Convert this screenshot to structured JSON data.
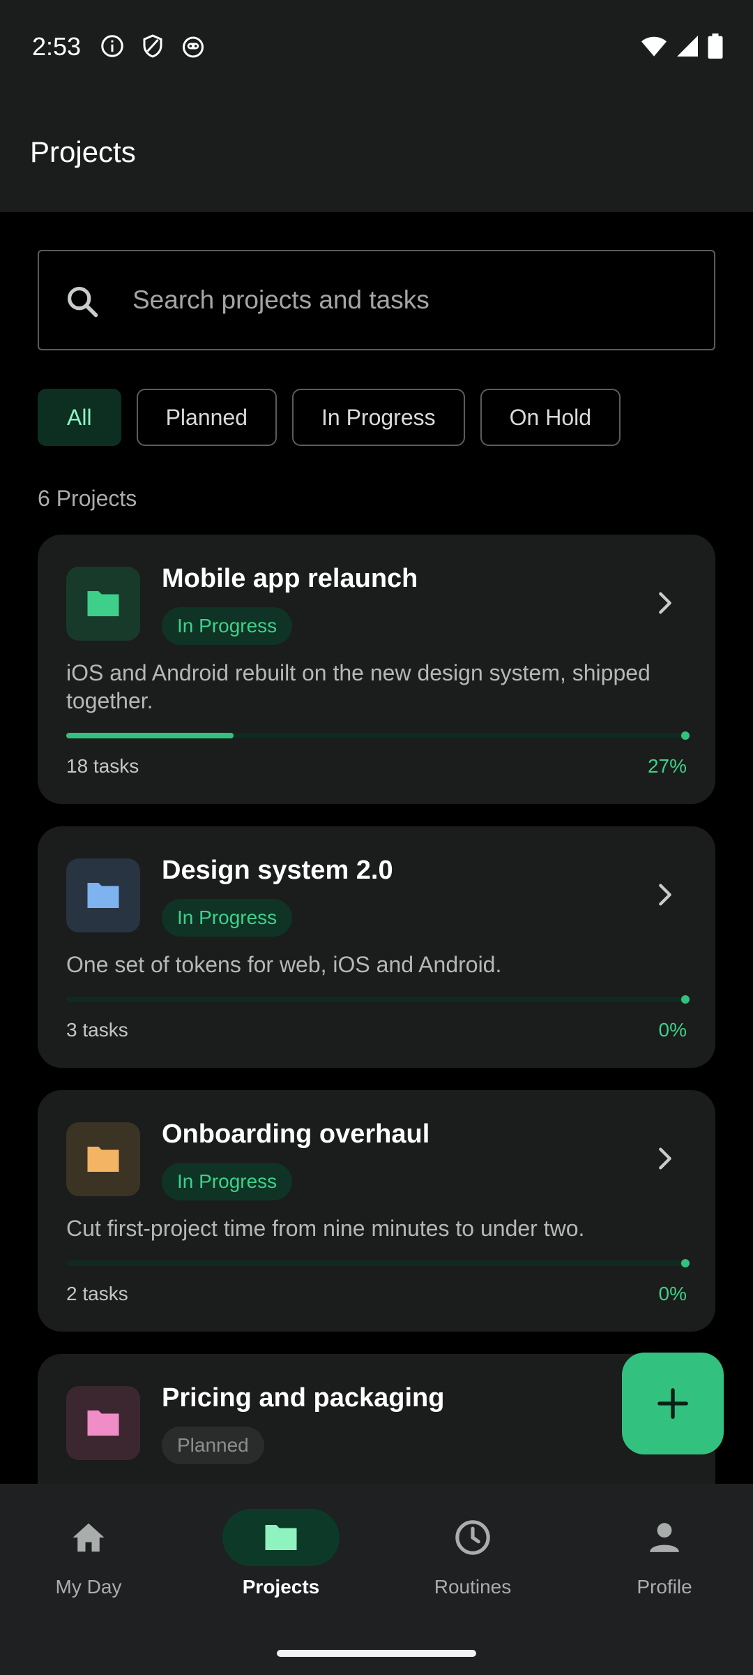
{
  "status_bar": {
    "time": "2:53",
    "left_icons": [
      "info-icon",
      "shield-icon",
      "robot-icon"
    ],
    "right_icons": [
      "wifi-icon",
      "signal-icon",
      "battery-icon"
    ]
  },
  "app_bar": {
    "title": "Projects"
  },
  "search": {
    "placeholder": "Search projects and tasks",
    "value": ""
  },
  "filters": [
    {
      "label": "All",
      "active": true
    },
    {
      "label": "Planned",
      "active": false
    },
    {
      "label": "In Progress",
      "active": false
    },
    {
      "label": "On Hold",
      "active": false
    }
  ],
  "project_count": "6 Projects",
  "projects": [
    {
      "title": "Mobile app relaunch",
      "status": "In Progress",
      "description": "iOS and Android rebuilt on the new design system, shipped together.",
      "tasks": "18 tasks",
      "percent": "27%",
      "progress": 0.27,
      "icon_color": "#3ecf8a",
      "icon_bg": "#173a2a"
    },
    {
      "title": "Design system 2.0",
      "status": "In Progress",
      "description": "One set of tokens for web, iOS and Android.",
      "tasks": "3 tasks",
      "percent": "0%",
      "progress": 0,
      "icon_color": "#7fb3f0",
      "icon_bg": "#283442"
    },
    {
      "title": "Onboarding overhaul",
      "status": "In Progress",
      "description": "Cut first-project time from nine minutes to under two.",
      "tasks": "2 tasks",
      "percent": "0%",
      "progress": 0,
      "icon_color": "#f3b463",
      "icon_bg": "#3b3324"
    },
    {
      "title": "Pricing and packaging",
      "status": "Planned",
      "icon_color": "#f08dc7",
      "icon_bg": "#3c2731"
    }
  ],
  "fab": {
    "icon": "plus-icon"
  },
  "bottom_nav": [
    {
      "label": "My Day",
      "icon": "home-icon",
      "active": false
    },
    {
      "label": "Projects",
      "icon": "folder-icon",
      "active": true
    },
    {
      "label": "Routines",
      "icon": "clock-icon",
      "active": false
    },
    {
      "label": "Profile",
      "icon": "person-icon",
      "active": false
    }
  ],
  "colors": {
    "accent": "#33c17f",
    "accent_light": "#8ff3c0",
    "surface": "#1b1c1c",
    "background": "#000000"
  }
}
